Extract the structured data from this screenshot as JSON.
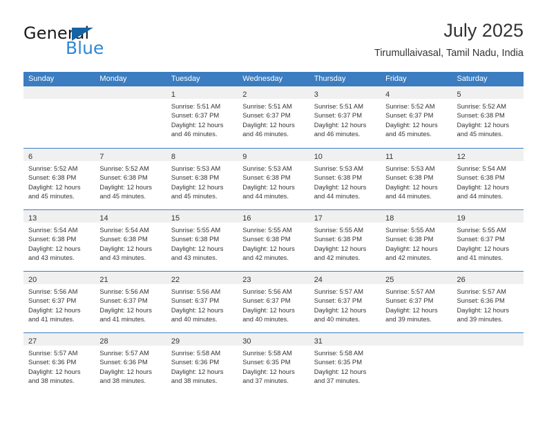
{
  "brand": {
    "name_top": "General",
    "name_bottom": "Blue",
    "triangle_color": "#1464a5",
    "blue_color": "#2f87d4"
  },
  "header": {
    "title": "July 2025",
    "subtitle": "Tirumullaivasal, Tamil Nadu, India"
  },
  "theme": {
    "header_blue": "#3b7dc0",
    "day_band_gray": "#f0f0f0",
    "text": "#333333"
  },
  "weekdays": [
    "Sunday",
    "Monday",
    "Tuesday",
    "Wednesday",
    "Thursday",
    "Friday",
    "Saturday"
  ],
  "weeks": [
    [
      {
        "day": "",
        "sunrise": "",
        "sunset": "",
        "daylight1": "",
        "daylight2": ""
      },
      {
        "day": "",
        "sunrise": "",
        "sunset": "",
        "daylight1": "",
        "daylight2": ""
      },
      {
        "day": "1",
        "sunrise": "Sunrise: 5:51 AM",
        "sunset": "Sunset: 6:37 PM",
        "daylight1": "Daylight: 12 hours",
        "daylight2": "and 46 minutes."
      },
      {
        "day": "2",
        "sunrise": "Sunrise: 5:51 AM",
        "sunset": "Sunset: 6:37 PM",
        "daylight1": "Daylight: 12 hours",
        "daylight2": "and 46 minutes."
      },
      {
        "day": "3",
        "sunrise": "Sunrise: 5:51 AM",
        "sunset": "Sunset: 6:37 PM",
        "daylight1": "Daylight: 12 hours",
        "daylight2": "and 46 minutes."
      },
      {
        "day": "4",
        "sunrise": "Sunrise: 5:52 AM",
        "sunset": "Sunset: 6:37 PM",
        "daylight1": "Daylight: 12 hours",
        "daylight2": "and 45 minutes."
      },
      {
        "day": "5",
        "sunrise": "Sunrise: 5:52 AM",
        "sunset": "Sunset: 6:38 PM",
        "daylight1": "Daylight: 12 hours",
        "daylight2": "and 45 minutes."
      }
    ],
    [
      {
        "day": "6",
        "sunrise": "Sunrise: 5:52 AM",
        "sunset": "Sunset: 6:38 PM",
        "daylight1": "Daylight: 12 hours",
        "daylight2": "and 45 minutes."
      },
      {
        "day": "7",
        "sunrise": "Sunrise: 5:52 AM",
        "sunset": "Sunset: 6:38 PM",
        "daylight1": "Daylight: 12 hours",
        "daylight2": "and 45 minutes."
      },
      {
        "day": "8",
        "sunrise": "Sunrise: 5:53 AM",
        "sunset": "Sunset: 6:38 PM",
        "daylight1": "Daylight: 12 hours",
        "daylight2": "and 45 minutes."
      },
      {
        "day": "9",
        "sunrise": "Sunrise: 5:53 AM",
        "sunset": "Sunset: 6:38 PM",
        "daylight1": "Daylight: 12 hours",
        "daylight2": "and 44 minutes."
      },
      {
        "day": "10",
        "sunrise": "Sunrise: 5:53 AM",
        "sunset": "Sunset: 6:38 PM",
        "daylight1": "Daylight: 12 hours",
        "daylight2": "and 44 minutes."
      },
      {
        "day": "11",
        "sunrise": "Sunrise: 5:53 AM",
        "sunset": "Sunset: 6:38 PM",
        "daylight1": "Daylight: 12 hours",
        "daylight2": "and 44 minutes."
      },
      {
        "day": "12",
        "sunrise": "Sunrise: 5:54 AM",
        "sunset": "Sunset: 6:38 PM",
        "daylight1": "Daylight: 12 hours",
        "daylight2": "and 44 minutes."
      }
    ],
    [
      {
        "day": "13",
        "sunrise": "Sunrise: 5:54 AM",
        "sunset": "Sunset: 6:38 PM",
        "daylight1": "Daylight: 12 hours",
        "daylight2": "and 43 minutes."
      },
      {
        "day": "14",
        "sunrise": "Sunrise: 5:54 AM",
        "sunset": "Sunset: 6:38 PM",
        "daylight1": "Daylight: 12 hours",
        "daylight2": "and 43 minutes."
      },
      {
        "day": "15",
        "sunrise": "Sunrise: 5:55 AM",
        "sunset": "Sunset: 6:38 PM",
        "daylight1": "Daylight: 12 hours",
        "daylight2": "and 43 minutes."
      },
      {
        "day": "16",
        "sunrise": "Sunrise: 5:55 AM",
        "sunset": "Sunset: 6:38 PM",
        "daylight1": "Daylight: 12 hours",
        "daylight2": "and 42 minutes."
      },
      {
        "day": "17",
        "sunrise": "Sunrise: 5:55 AM",
        "sunset": "Sunset: 6:38 PM",
        "daylight1": "Daylight: 12 hours",
        "daylight2": "and 42 minutes."
      },
      {
        "day": "18",
        "sunrise": "Sunrise: 5:55 AM",
        "sunset": "Sunset: 6:38 PM",
        "daylight1": "Daylight: 12 hours",
        "daylight2": "and 42 minutes."
      },
      {
        "day": "19",
        "sunrise": "Sunrise: 5:55 AM",
        "sunset": "Sunset: 6:37 PM",
        "daylight1": "Daylight: 12 hours",
        "daylight2": "and 41 minutes."
      }
    ],
    [
      {
        "day": "20",
        "sunrise": "Sunrise: 5:56 AM",
        "sunset": "Sunset: 6:37 PM",
        "daylight1": "Daylight: 12 hours",
        "daylight2": "and 41 minutes."
      },
      {
        "day": "21",
        "sunrise": "Sunrise: 5:56 AM",
        "sunset": "Sunset: 6:37 PM",
        "daylight1": "Daylight: 12 hours",
        "daylight2": "and 41 minutes."
      },
      {
        "day": "22",
        "sunrise": "Sunrise: 5:56 AM",
        "sunset": "Sunset: 6:37 PM",
        "daylight1": "Daylight: 12 hours",
        "daylight2": "and 40 minutes."
      },
      {
        "day": "23",
        "sunrise": "Sunrise: 5:56 AM",
        "sunset": "Sunset: 6:37 PM",
        "daylight1": "Daylight: 12 hours",
        "daylight2": "and 40 minutes."
      },
      {
        "day": "24",
        "sunrise": "Sunrise: 5:57 AM",
        "sunset": "Sunset: 6:37 PM",
        "daylight1": "Daylight: 12 hours",
        "daylight2": "and 40 minutes."
      },
      {
        "day": "25",
        "sunrise": "Sunrise: 5:57 AM",
        "sunset": "Sunset: 6:37 PM",
        "daylight1": "Daylight: 12 hours",
        "daylight2": "and 39 minutes."
      },
      {
        "day": "26",
        "sunrise": "Sunrise: 5:57 AM",
        "sunset": "Sunset: 6:36 PM",
        "daylight1": "Daylight: 12 hours",
        "daylight2": "and 39 minutes."
      }
    ],
    [
      {
        "day": "27",
        "sunrise": "Sunrise: 5:57 AM",
        "sunset": "Sunset: 6:36 PM",
        "daylight1": "Daylight: 12 hours",
        "daylight2": "and 38 minutes."
      },
      {
        "day": "28",
        "sunrise": "Sunrise: 5:57 AM",
        "sunset": "Sunset: 6:36 PM",
        "daylight1": "Daylight: 12 hours",
        "daylight2": "and 38 minutes."
      },
      {
        "day": "29",
        "sunrise": "Sunrise: 5:58 AM",
        "sunset": "Sunset: 6:36 PM",
        "daylight1": "Daylight: 12 hours",
        "daylight2": "and 38 minutes."
      },
      {
        "day": "30",
        "sunrise": "Sunrise: 5:58 AM",
        "sunset": "Sunset: 6:35 PM",
        "daylight1": "Daylight: 12 hours",
        "daylight2": "and 37 minutes."
      },
      {
        "day": "31",
        "sunrise": "Sunrise: 5:58 AM",
        "sunset": "Sunset: 6:35 PM",
        "daylight1": "Daylight: 12 hours",
        "daylight2": "and 37 minutes."
      },
      {
        "day": "",
        "sunrise": "",
        "sunset": "",
        "daylight1": "",
        "daylight2": ""
      },
      {
        "day": "",
        "sunrise": "",
        "sunset": "",
        "daylight1": "",
        "daylight2": ""
      }
    ]
  ]
}
